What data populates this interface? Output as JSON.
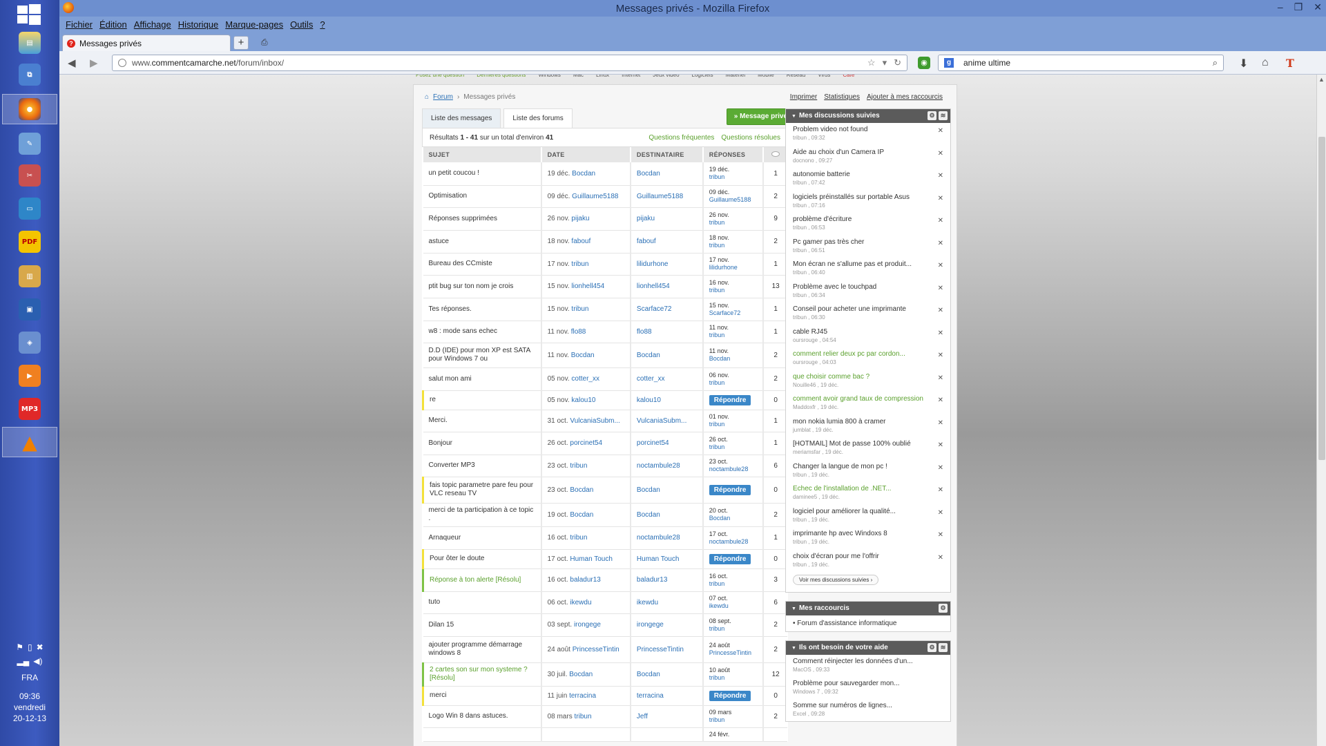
{
  "window": {
    "title": "Messages privés - Mozilla Firefox"
  },
  "menu": [
    "Fichier",
    "Édition",
    "Affichage",
    "Historique",
    "Marque-pages",
    "Outils",
    "?"
  ],
  "tab": {
    "title": "Messages privés"
  },
  "address": {
    "prefix": "www.",
    "domain": "commentcamarche.net",
    "path": "/forum/inbox/"
  },
  "search": {
    "value": "anime ultime"
  },
  "taskbar": {
    "lang": "FRA",
    "time": "09:36",
    "day": "vendredi",
    "date": "20-12-13"
  },
  "topnav": [
    {
      "t": "Posez une question",
      "c": "g"
    },
    {
      "t": "Dernières questions",
      "c": "g"
    },
    {
      "t": "Windows",
      "c": ""
    },
    {
      "t": "Mac",
      "c": ""
    },
    {
      "t": "Linux",
      "c": ""
    },
    {
      "t": "Internet",
      "c": ""
    },
    {
      "t": "Jeux vidéo",
      "c": ""
    },
    {
      "t": "Logiciels",
      "c": ""
    },
    {
      "t": "Matériel",
      "c": ""
    },
    {
      "t": "Mobile",
      "c": ""
    },
    {
      "t": "Réseau",
      "c": ""
    },
    {
      "t": "Virus",
      "c": ""
    },
    {
      "t": "Café",
      "c": "r"
    }
  ],
  "breadcrumb": {
    "forum": "Forum",
    "current": "Messages privés"
  },
  "toplinks": [
    "Imprimer",
    "Statistiques",
    "Ajouter à mes raccourcis"
  ],
  "tabs": [
    "Liste des messages",
    "Liste des forums"
  ],
  "new_message_btn": "» Message privé",
  "results": {
    "text_prefix": "Résultats ",
    "range": "1 - 41",
    "mid": " sur un total d'environ ",
    "total": "41",
    "faq": "Questions fréquentes",
    "resolved": "Questions résolues"
  },
  "table": {
    "headers": [
      "SUJET",
      "DATE",
      "DESTINATAIRE",
      "RÉPONSES",
      ""
    ],
    "reply_label": "Répondre",
    "rows": [
      {
        "subject": "un petit coucou !",
        "date": "19 déc.",
        "author": "Bocdan",
        "recipient": "Bocdan",
        "last_date": "19 déc.",
        "last_by": "tribun",
        "count": "1",
        "state": "",
        "h": 33
      },
      {
        "subject": "Optimisation",
        "date": "09 déc.",
        "author": "Guillaume5188",
        "recipient": "Guillaume5188",
        "last_date": "09 déc.",
        "last_by": "Guillaume5188",
        "count": "2",
        "state": "",
        "h": 32
      },
      {
        "subject": "Réponses supprimées",
        "date": "26 nov.",
        "author": "pijaku",
        "recipient": "pijaku",
        "last_date": "26 nov.",
        "last_by": "tribun",
        "count": "9",
        "state": "",
        "h": 33
      },
      {
        "subject": "astuce",
        "date": "18 nov.",
        "author": "fabouf",
        "recipient": "fabouf",
        "last_date": "18 nov.",
        "last_by": "tribun",
        "count": "2",
        "state": "",
        "h": 33
      },
      {
        "subject": "Bureau des CCmiste",
        "date": "17 nov.",
        "author": "tribun",
        "recipient": "lilidurhone",
        "last_date": "17 nov.",
        "last_by": "lilidurhone",
        "count": "1",
        "state": "",
        "h": 32
      },
      {
        "subject": "ptit bug sur ton nom je crois",
        "date": "15 nov.",
        "author": "lionhell454",
        "recipient": "lionhell454",
        "last_date": "16 nov.",
        "last_by": "tribun",
        "count": "13",
        "state": "",
        "h": 33
      },
      {
        "subject": "Tes réponses.",
        "date": "15 nov.",
        "author": "tribun",
        "recipient": "Scarface72",
        "last_date": "15 nov.",
        "last_by": "Scarface72",
        "count": "1",
        "state": "",
        "h": 33
      },
      {
        "subject": "w8 : mode sans echec",
        "date": "11 nov.",
        "author": "flo88",
        "recipient": "flo88",
        "last_date": "11 nov.",
        "last_by": "tribun",
        "count": "1",
        "state": "",
        "h": 32
      },
      {
        "subject": "D.D (IDE) pour mon XP est SATA pour Windows 7 ou",
        "date": "11 nov.",
        "author": "Bocdan",
        "recipient": "Bocdan",
        "last_date": "11 nov.",
        "last_by": "Bocdan",
        "count": "2",
        "state": "",
        "h": 36
      },
      {
        "subject": "salut mon ami",
        "date": "05 nov.",
        "author": "cotter_xx",
        "recipient": "cotter_xx",
        "last_date": "06 nov.",
        "last_by": "tribun",
        "count": "2",
        "state": "",
        "h": 33
      },
      {
        "subject": "re",
        "date": "05 nov.",
        "author": "kalou10",
        "recipient": "kalou10",
        "last_date": "",
        "last_by": "",
        "count": "0",
        "state": "unread",
        "h": 28
      },
      {
        "subject": "Merci.",
        "date": "31 oct.",
        "author": "VulcaniaSubm...",
        "recipient": "VulcaniaSubm...",
        "last_date": "01 nov.",
        "last_by": "tribun",
        "count": "1",
        "state": "",
        "h": 32
      },
      {
        "subject": "Bonjour",
        "date": "26 oct.",
        "author": "porcinet54",
        "recipient": "porcinet54",
        "last_date": "26 oct.",
        "last_by": "tribun",
        "count": "1",
        "state": "",
        "h": 33
      },
      {
        "subject": "Converter MP3",
        "date": "23 oct.",
        "author": "tribun",
        "recipient": "noctambule28",
        "last_date": "23 oct.",
        "last_by": "noctambule28",
        "count": "6",
        "state": "",
        "h": 32
      },
      {
        "subject": "fais topic parametre pare feu pour VLC reseau TV",
        "date": "23 oct.",
        "author": "Bocdan",
        "recipient": "Bocdan",
        "last_date": "",
        "last_by": "",
        "count": "0",
        "state": "unread",
        "h": 38
      },
      {
        "subject": "merci de ta participation à ce topic .",
        "date": "19 oct.",
        "author": "Bocdan",
        "recipient": "Bocdan",
        "last_date": "20 oct.",
        "last_by": "Bocdan",
        "count": "2",
        "state": "",
        "h": 34
      },
      {
        "subject": "Arnaqueur",
        "date": "16 oct.",
        "author": "tribun",
        "recipient": "noctambule28",
        "last_date": "17 oct.",
        "last_by": "noctambule28",
        "count": "1",
        "state": "",
        "h": 33
      },
      {
        "subject": "Pour ôter le doute",
        "date": "17 oct.",
        "author": "Human Touch",
        "recipient": "Human Touch",
        "last_date": "",
        "last_by": "",
        "count": "0",
        "state": "unread",
        "h": 28
      },
      {
        "subject": "Réponse à ton alerte [Résolu]",
        "date": "16 oct.",
        "author": "baladur13",
        "recipient": "baladur13",
        "last_date": "16 oct.",
        "last_by": "tribun",
        "count": "3",
        "state": "resolved",
        "h": 33
      },
      {
        "subject": "tuto",
        "date": "06 oct.",
        "author": "ikewdu",
        "recipient": "ikewdu",
        "last_date": "07 oct.",
        "last_by": "ikewdu",
        "count": "6",
        "state": "",
        "h": 32
      },
      {
        "subject": "Dilan 15",
        "date": "03 sept.",
        "author": "irongege",
        "recipient": "irongege",
        "last_date": "08 sept.",
        "last_by": "tribun",
        "count": "2",
        "state": "",
        "h": 33
      },
      {
        "subject": "ajouter programme démarrage windows 8",
        "date": "24 août",
        "author": "PrincesseTintin",
        "recipient": "PrincesseTintin",
        "last_date": "24 août",
        "last_by": "PrincesseTintin",
        "count": "2",
        "state": "",
        "h": 38
      },
      {
        "subject": "2 cartes son sur mon systeme ? [Résolu]",
        "date": "30 juil.",
        "author": "Bocdan",
        "recipient": "Bocdan",
        "last_date": "10 août",
        "last_by": "tribun",
        "count": "12",
        "state": "resolved",
        "h": 34
      },
      {
        "subject": "merci",
        "date": "11 juin",
        "author": "terracina",
        "recipient": "terracina",
        "last_date": "",
        "last_by": "",
        "count": "0",
        "state": "unread",
        "h": 28
      },
      {
        "subject": "Logo Win 8 dans astuces.",
        "date": "08 mars",
        "author": "tribun",
        "recipient": "Jeff",
        "last_date": "09 mars",
        "last_by": "tribun",
        "count": "2",
        "state": "",
        "h": 32
      },
      {
        "subject": "",
        "date": "",
        "author": "",
        "recipient": "",
        "last_date": "24 févr.",
        "last_by": "",
        "count": "",
        "state": "",
        "h": 20
      }
    ]
  },
  "sidebar": {
    "followed": {
      "title": "Mes discussions suivies",
      "button": "Voir mes discussions suivies",
      "items": [
        {
          "t": "Problem video not found",
          "s": "tribun , 09:32",
          "g": false
        },
        {
          "t": "Aide au choix d'un Camera IP",
          "s": "docnono , 09:27",
          "g": false
        },
        {
          "t": "autonomie batterie",
          "s": "tribun , 07:42",
          "g": false
        },
        {
          "t": "logiciels préinstallés sur portable Asus",
          "s": "tribun , 07:16",
          "g": false
        },
        {
          "t": "problème d'écriture",
          "s": "tribun , 06:53",
          "g": false
        },
        {
          "t": "Pc gamer pas très cher",
          "s": "tribun , 06:51",
          "g": false
        },
        {
          "t": "Mon écran ne s'allume pas et produit...",
          "s": "tribun , 06:40",
          "g": false
        },
        {
          "t": "Problème avec le touchpad",
          "s": "tribun , 06:34",
          "g": false
        },
        {
          "t": "Conseil pour acheter une imprimante",
          "s": "tribun , 06:30",
          "g": false
        },
        {
          "t": "cable RJ45",
          "s": "oursrouge , 04:54",
          "g": false
        },
        {
          "t": "comment relier deux pc par cordon...",
          "s": "oursrouge , 04:03",
          "g": true
        },
        {
          "t": "que choisir comme bac ?",
          "s": "Nouille46 , 19 déc.",
          "g": true
        },
        {
          "t": "comment avoir grand taux de compression",
          "s": "Maddoxfr , 19 déc.",
          "g": true
        },
        {
          "t": "mon nokia lumia 800 à cramer",
          "s": "jumblat , 19 déc.",
          "g": false
        },
        {
          "t": "[HOTMAIL] Mot de passe 100% oublié",
          "s": "meriamsfar , 19 déc.",
          "g": false
        },
        {
          "t": "Changer la langue de mon pc !",
          "s": "tribun , 19 déc.",
          "g": false
        },
        {
          "t": "Echec de l'installation de .NET...",
          "s": "daminee5 , 19 déc.",
          "g": true
        },
        {
          "t": "logiciel pour améliorer la qualité...",
          "s": "tribun , 19 déc.",
          "g": false
        },
        {
          "t": "imprimante hp avec Windoxs 8",
          "s": "tribun , 19 déc.",
          "g": false
        },
        {
          "t": "choix d'écran pour me l'offrir",
          "s": "tribun , 19 déc.",
          "g": false
        }
      ]
    },
    "shortcuts": {
      "title": "Mes raccourcis",
      "items": [
        "Forum d'assistance informatique"
      ]
    },
    "help": {
      "title": "Ils ont besoin de votre aide",
      "items": [
        {
          "t": "Comment réinjecter les données d'un...",
          "s": "MacOS , 09:33"
        },
        {
          "t": "Problème pour sauvegarder mon...",
          "s": "Windows 7 , 09:32"
        },
        {
          "t": "Somme sur numéros de lignes...",
          "s": "Excel , 09:28"
        }
      ]
    }
  }
}
